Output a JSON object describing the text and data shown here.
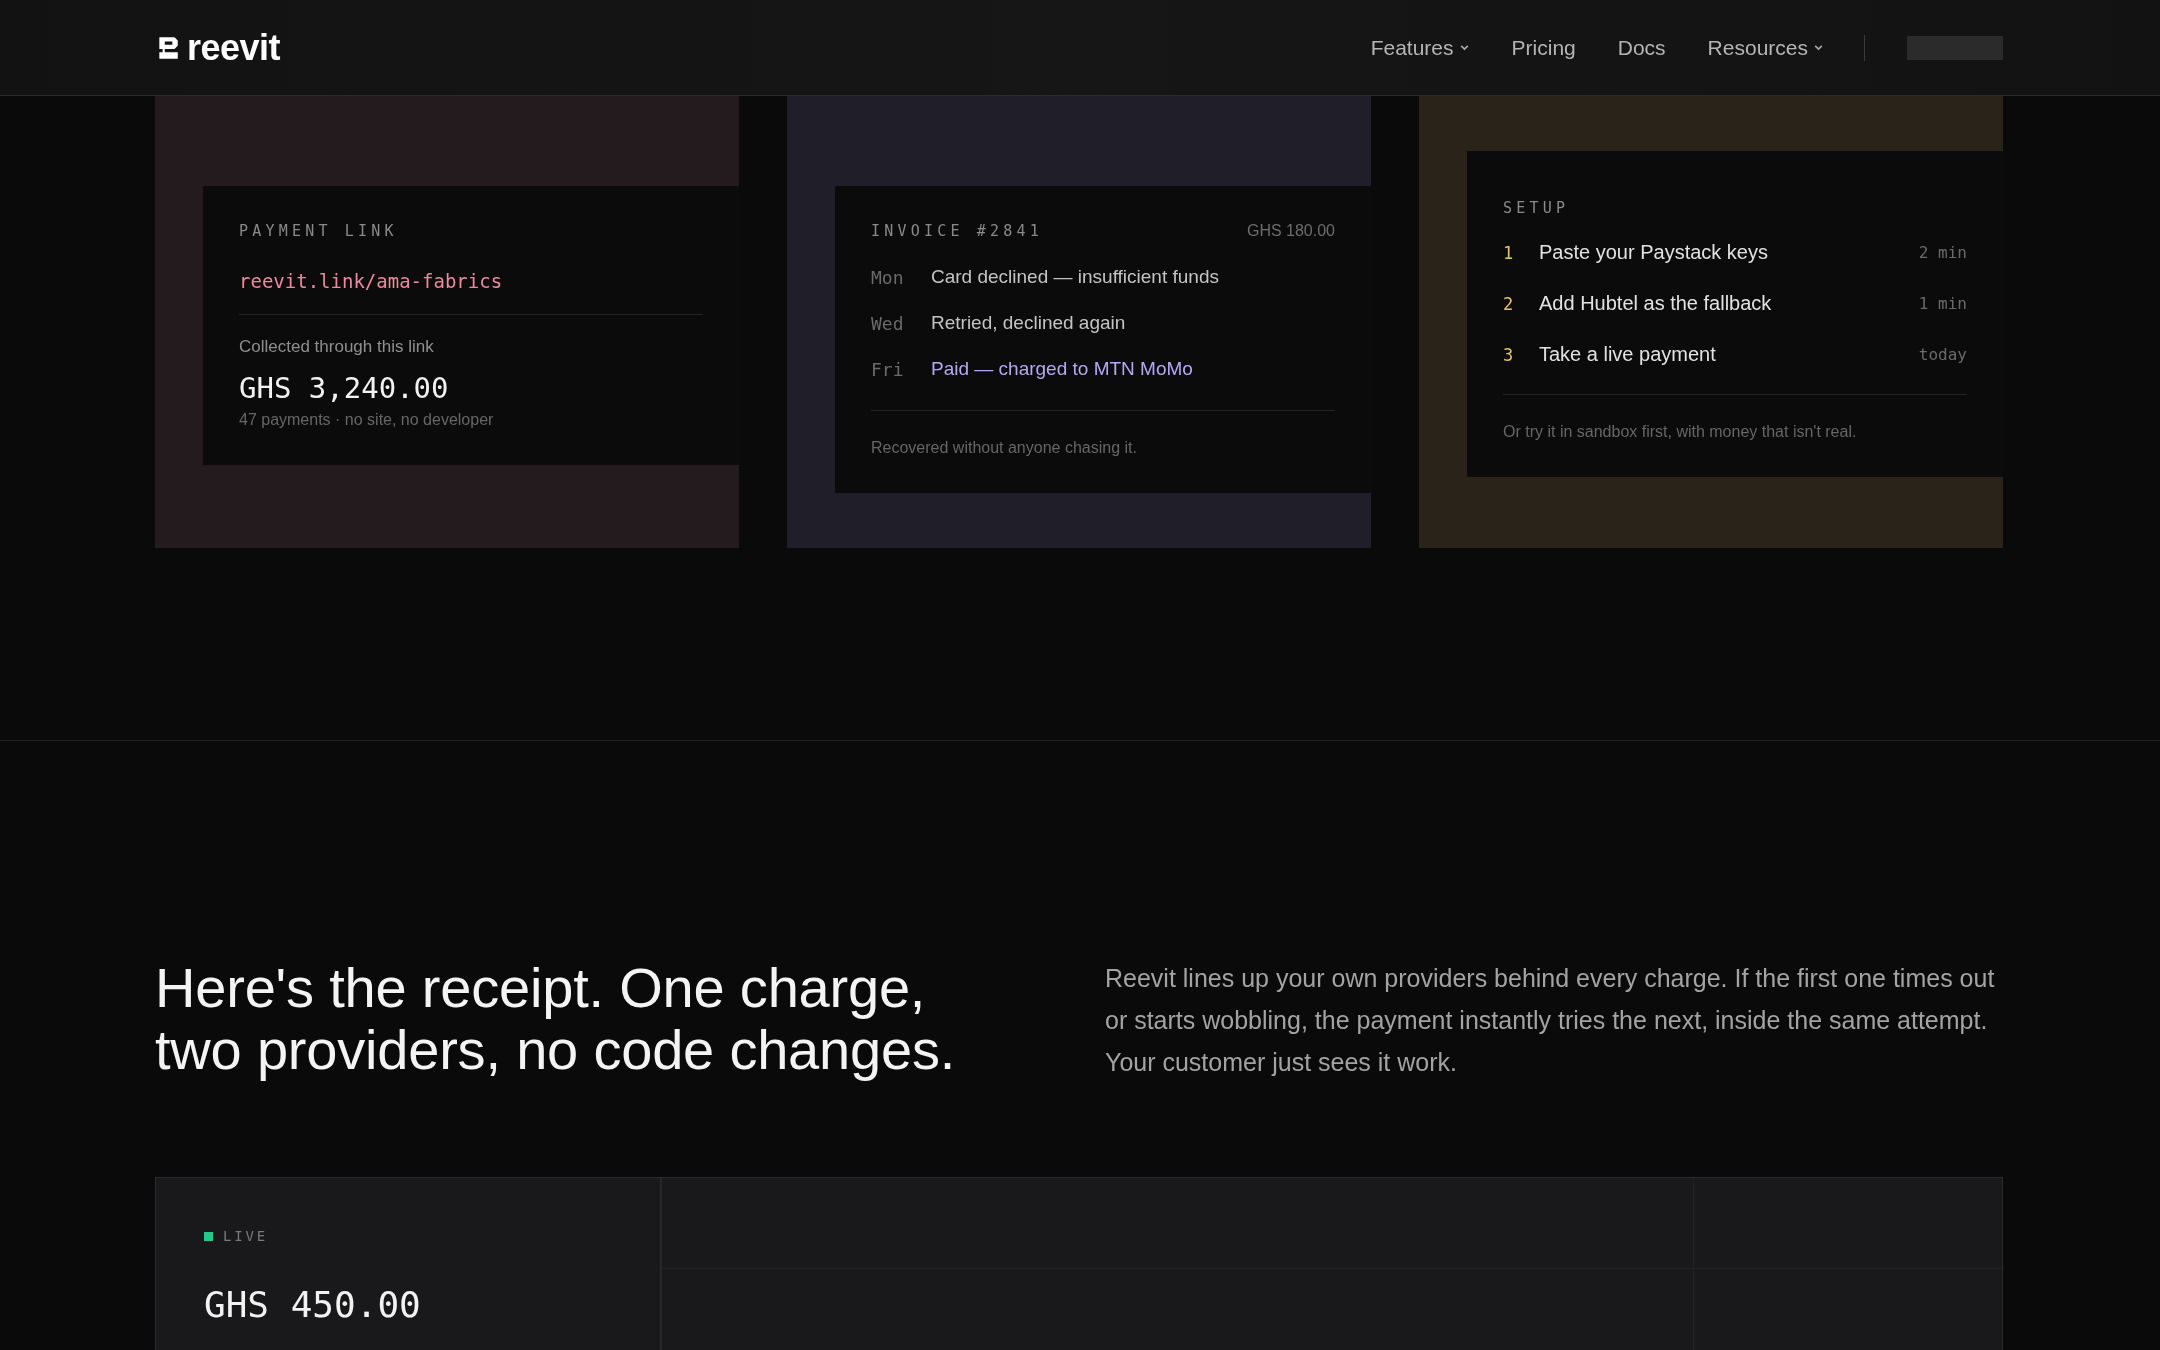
{
  "header": {
    "logo": "reevit",
    "nav": [
      {
        "label": "Features",
        "dropdown": true
      },
      {
        "label": "Pricing",
        "dropdown": false
      },
      {
        "label": "Docs",
        "dropdown": false
      },
      {
        "label": "Resources",
        "dropdown": true
      }
    ]
  },
  "cards": [
    {
      "kind": "link",
      "label": "PAYMENT LINK",
      "link": "reevit.link/ama-fabrics",
      "caption": "Collected through this link",
      "amount": "GHS 3,240.00",
      "note": "47 payments · no site, no developer"
    },
    {
      "kind": "invoice",
      "label": "INVOICE #2841",
      "total": "GHS 180.00",
      "events": [
        {
          "day": "Mon",
          "text": "Card declined — insufficient funds",
          "success": false
        },
        {
          "day": "Wed",
          "text": "Retried, declined again",
          "success": false
        },
        {
          "day": "Fri",
          "text": "Paid — charged to MTN MoMo",
          "success": true
        }
      ],
      "note": "Recovered without anyone chasing it."
    },
    {
      "kind": "setup",
      "label": "SETUP",
      "steps": [
        {
          "number": "1",
          "text": "Paste your Paystack keys",
          "time": "2 min"
        },
        {
          "number": "2",
          "text": "Add Hubtel as the fallback",
          "time": "1 min"
        },
        {
          "number": "3",
          "text": "Take a live payment",
          "time": "today"
        }
      ],
      "note": "Or try it in sandbox first, with money that isn't real."
    }
  ],
  "receipt": {
    "heading": "Here's the receipt. One charge, two providers, no code changes.",
    "body": "Reevit lines up your own providers behind every charge. If the first one times out or starts wobbling, the payment instantly tries the next, inside the same attempt. Your customer just sees it work.",
    "status": "LIVE",
    "amount": "GHS 450.00"
  }
}
